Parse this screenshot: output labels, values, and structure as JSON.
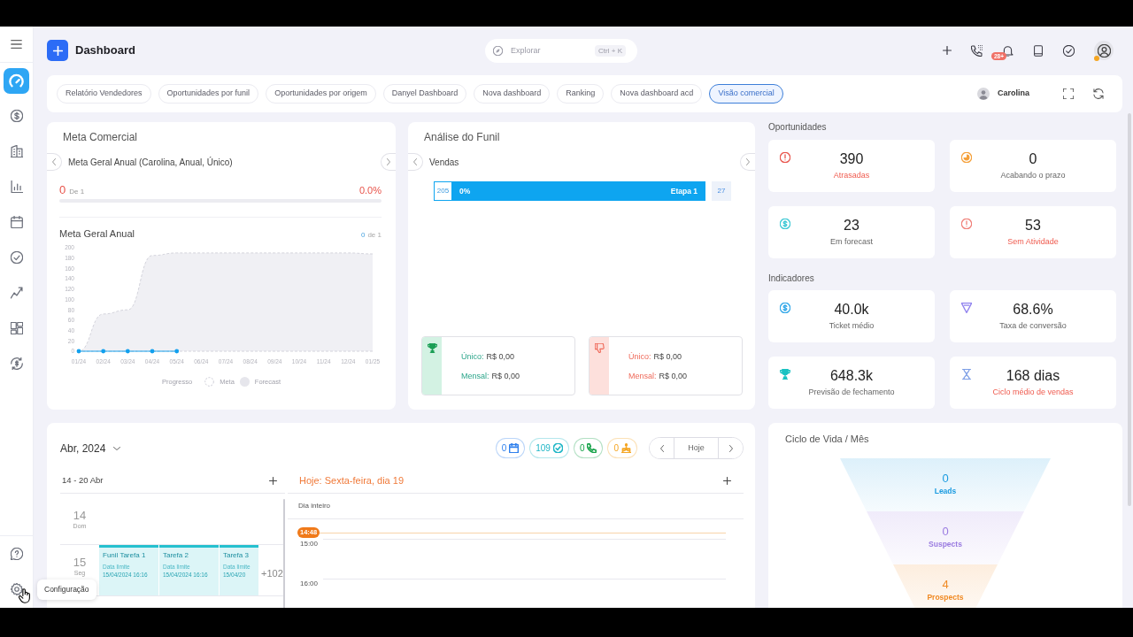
{
  "sidebar": {
    "items": [
      {
        "selected": true
      },
      {
        "selected": false
      },
      {
        "selected": false
      },
      {
        "selected": false
      },
      {
        "selected": false
      },
      {
        "selected": false
      },
      {
        "selected": false
      },
      {
        "selected": false
      },
      {
        "selected": false
      }
    ],
    "footer_items": [
      {
        "selected": false
      },
      {
        "selected": false
      }
    ],
    "tooltip": "Configuração"
  },
  "header": {
    "title": "Dashboard",
    "search": {
      "placeholder": "Explorar",
      "shortcut": "Ctrl + K"
    },
    "notification_count": "28+"
  },
  "dashboard_tabs": [
    {
      "label": "Relatório Vendedores",
      "selected": false
    },
    {
      "label": "Oportunidades por funil",
      "selected": false
    },
    {
      "label": "Oportunidades por origem",
      "selected": false
    },
    {
      "label": "Danyel Dashboard",
      "selected": false
    },
    {
      "label": "Nova dashboard",
      "selected": false
    },
    {
      "label": "Ranking",
      "selected": false
    },
    {
      "label": "Nova dashboard acd",
      "selected": false
    },
    {
      "label": "Visão comercial",
      "selected": true
    }
  ],
  "user": {
    "name": "Carolina"
  },
  "meta_comercial": {
    "title": "Meta Comercial",
    "goal_name": "Meta Geral Anual (Carolina, Anual, Único)",
    "achieved": "0",
    "of_total": "De 1",
    "percent": "0.0%",
    "chart_achieved": "0",
    "chart_of_total": "de 1",
    "chart_data": {
      "type": "area",
      "title": "Meta Geral Anual",
      "categories": [
        "01/24",
        "02/24",
        "03/24",
        "04/24",
        "05/24",
        "06/24",
        "07/24",
        "08/24",
        "09/24",
        "10/24",
        "11/24",
        "12/24",
        "01/25"
      ],
      "series": [
        {
          "name": "Progresso",
          "type": "line",
          "color": "#12a0ee",
          "values": [
            0,
            0,
            0,
            0,
            0,
            null,
            null,
            null,
            null,
            null,
            null,
            null,
            null
          ]
        },
        {
          "name": "Meta",
          "type": "line",
          "color": "#c8c8d2",
          "values": [
            null,
            null,
            null,
            null,
            null,
            null,
            null,
            null,
            null,
            null,
            null,
            null,
            null
          ]
        },
        {
          "name": "Forecast",
          "type": "area",
          "color": "#f0f0f4",
          "values": [
            0,
            72,
            80,
            185,
            190,
            190,
            190,
            190,
            190,
            190,
            190,
            190,
            188
          ]
        }
      ],
      "ylim": [
        0,
        200
      ],
      "yticks": [
        0,
        20,
        40,
        60,
        80,
        100,
        120,
        140,
        160,
        180,
        200
      ]
    }
  },
  "funil": {
    "title": "Análise do Funil",
    "pipeline": "Vendas",
    "stages": [
      {
        "count": "205",
        "percent": "0%",
        "name": "Etapa 1",
        "total": "27"
      }
    ],
    "outcomes": [
      {
        "kind": "won",
        "unique_label": "Único:",
        "unique_value": "R$ 0,00",
        "monthly_label": "Mensal:",
        "monthly_value": "R$ 0,00"
      },
      {
        "kind": "lost",
        "unique_label": "Único:",
        "unique_value": "R$ 0,00",
        "monthly_label": "Mensal:",
        "monthly_value": "R$ 0,00"
      }
    ]
  },
  "oportunidades": {
    "title": "Oportunidades",
    "items": [
      {
        "kind": "alert",
        "color": "#e8534a",
        "value": "390",
        "label": "Atrasadas",
        "alert": true
      },
      {
        "kind": "timer",
        "color": "#f5a03a",
        "value": "0",
        "label": "Acabando o prazo",
        "alert": false
      },
      {
        "kind": "money",
        "color": "#3cc8d4",
        "value": "23",
        "label": "Em forecast",
        "alert": false
      },
      {
        "kind": "alert",
        "color": "#f07f78",
        "value": "53",
        "label": "Sem Atividade",
        "alert": true
      }
    ]
  },
  "indicadores": {
    "title": "Indicadores",
    "items": [
      {
        "kind": "money",
        "color": "#2fa6e8",
        "value": "40.0k",
        "label": "Ticket médio",
        "alert": false
      },
      {
        "kind": "filter",
        "color": "#9082ee",
        "value": "68.6%",
        "label": "Taxa de conversão",
        "alert": false
      },
      {
        "kind": "trophy",
        "color": "#19c2c2",
        "value": "648.3k",
        "label": "Previsão de fechamento",
        "alert": false
      },
      {
        "kind": "hourglass",
        "color": "#7c9ee6",
        "value": "168 dias",
        "label": "Ciclo médio de vendas",
        "alert": true
      }
    ]
  },
  "calendar": {
    "month": "Abr, 2024",
    "counters": [
      {
        "kind": "events",
        "color": "#2f80ed",
        "value": "0"
      },
      {
        "kind": "tasks",
        "color": "#1fb6c6",
        "value": "109"
      },
      {
        "kind": "calls",
        "color": "#17a34a",
        "value": "0"
      },
      {
        "kind": "birthdays",
        "color": "#f5a623",
        "value": "0"
      }
    ],
    "today_button": "Hoje",
    "week": {
      "range": "14 - 20 Abr",
      "days": [
        {
          "day": "14",
          "weekday": "Dom"
        },
        {
          "day": "15",
          "weekday": "Seg",
          "tasks": [
            {
              "title": "Funil Tarefa 1",
              "due_label": "Data limite",
              "due": "15/04/2024 16:16"
            },
            {
              "title": "Tarefa 2",
              "due_label": "Data limite",
              "due": "15/04/2024 16:16"
            },
            {
              "title": "Tarefa 3",
              "due_label": "Data limite",
              "due": "15/04/20"
            }
          ],
          "more": "+102"
        }
      ]
    },
    "day": {
      "title": "Hoje: Sexta-feira, dia 19",
      "all_day": "Dia inteiro",
      "now": "14:48",
      "hours": [
        "15:00",
        "16:00"
      ]
    }
  },
  "lifecycle": {
    "title": "Ciclo de Vida / Mês",
    "stages": [
      {
        "value": "0",
        "label": "Leads",
        "color": "#1a9be0"
      },
      {
        "value": "0",
        "label": "Suspects",
        "color": "#9a7be0"
      },
      {
        "value": "4",
        "label": "Prospects",
        "color": "#f08a24"
      }
    ]
  }
}
